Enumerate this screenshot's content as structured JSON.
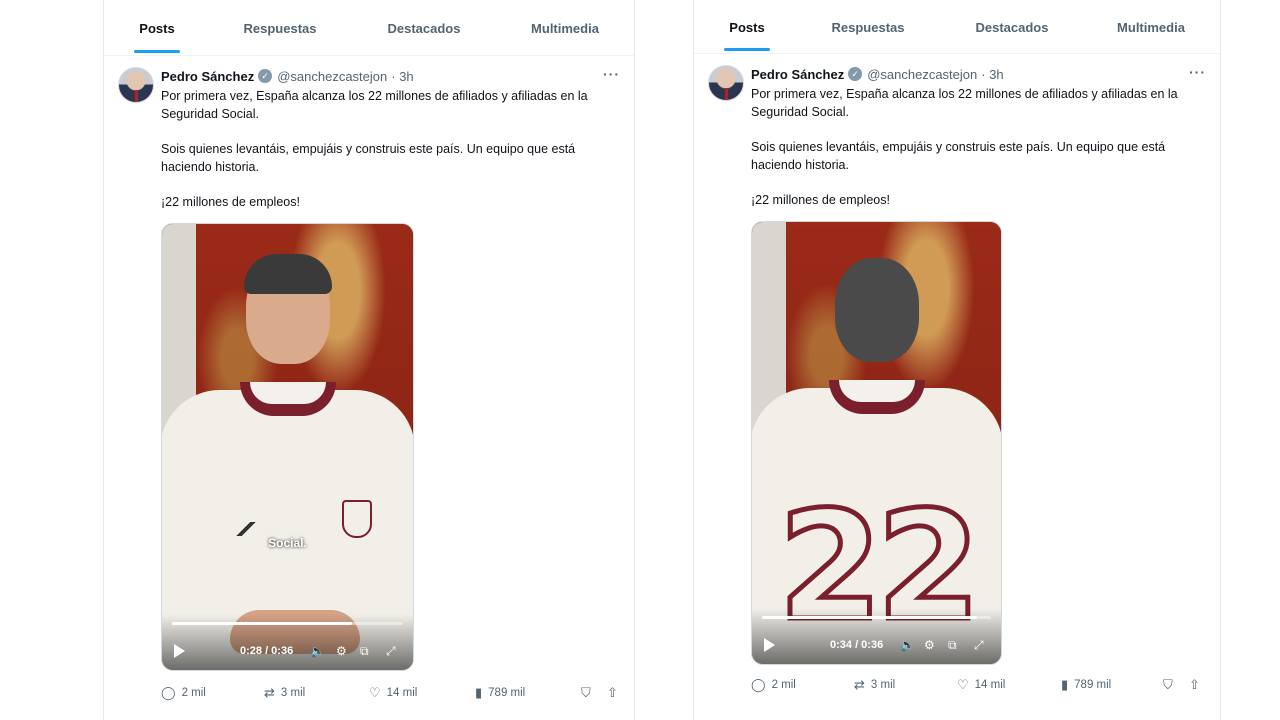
{
  "tabs": [
    "Posts",
    "Respuestas",
    "Destacados",
    "Multimedia"
  ],
  "tweets": [
    {
      "author_name": "Pedro Sánchez",
      "handle": "@sanchezcastejon",
      "time": "· 3h",
      "more": "···",
      "paragraphs": [
        "Por primera vez, España alcanza los 22 millones de afiliados y afiliadas en la Seguridad Social.",
        "Sois quienes levantáis, empujáis y construis este país. Un equipo que está haciendo historia.",
        "¡22 millones de empleos!"
      ],
      "video": {
        "caption": "Social.",
        "time_label": "0:28 / 0:36",
        "progress": 0.78
      },
      "stats": {
        "replies": "2 mil",
        "reposts": "3 mil",
        "likes": "14 mil",
        "views": "789 mil"
      }
    },
    {
      "author_name": "Pedro Sánchez",
      "handle": "@sanchezcastejon",
      "time": "· 3h",
      "more": "···",
      "paragraphs": [
        "Por primera vez, España alcanza los 22 millones de afiliados y afiliadas en la Seguridad Social.",
        "Sois quienes levantáis, empujáis y construis este país. Un equipo que está haciendo historia.",
        "¡22 millones de empleos!"
      ],
      "video": {
        "jersey_number": "22",
        "time_label": "0:34 / 0:36",
        "progress": 0.94
      },
      "stats": {
        "replies": "2 mil",
        "reposts": "3 mil",
        "likes": "14 mil",
        "views": "789 mil"
      }
    }
  ],
  "colors": {
    "accent": "#1d9bf0",
    "secondary_text": "#536471",
    "jersey_trim": "#7a1f2b"
  },
  "icons": [
    "verified-badge-icon",
    "more-icon",
    "play-icon",
    "volume-icon",
    "settings-icon",
    "pip-icon",
    "fullscreen-icon",
    "reply-icon",
    "repost-icon",
    "like-icon",
    "views-icon",
    "bookmark-icon",
    "share-icon"
  ]
}
